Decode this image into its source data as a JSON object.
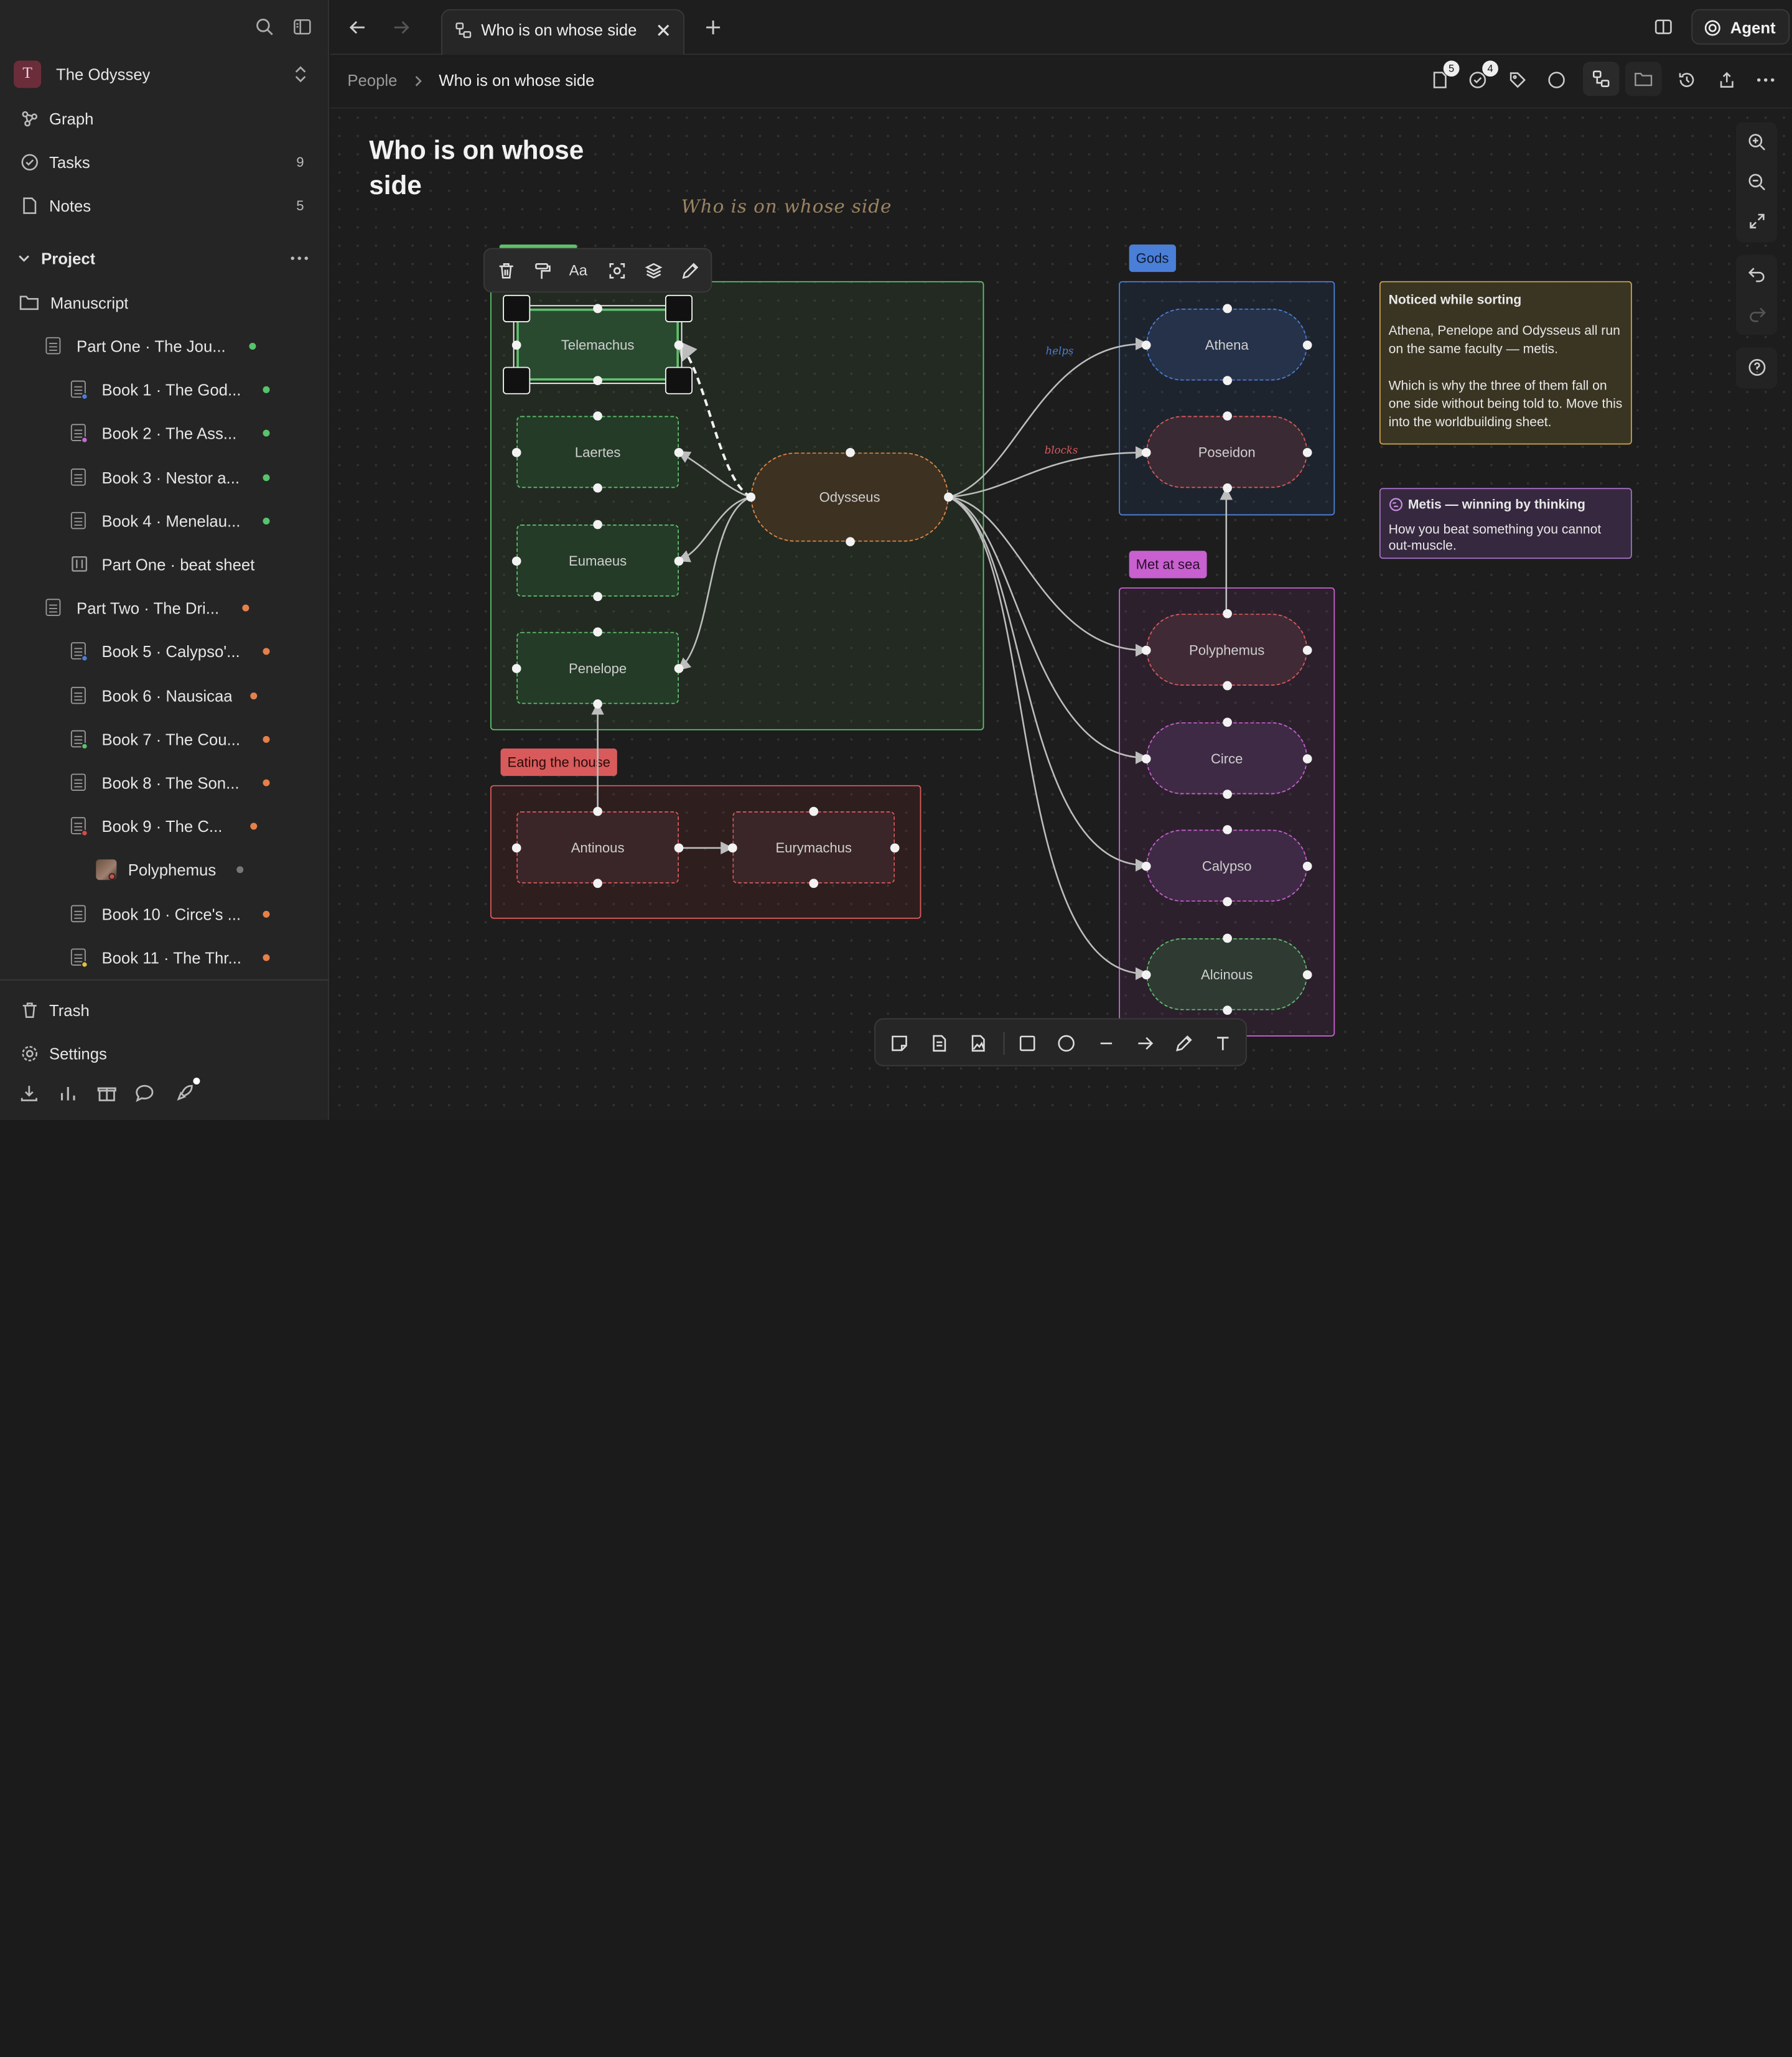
{
  "workspace": {
    "initial": "T",
    "name": "The Odyssey"
  },
  "nav": {
    "graph": "Graph",
    "tasks": "Tasks",
    "tasks_count": "9",
    "notes": "Notes",
    "notes_count": "5"
  },
  "project": {
    "label": "Project",
    "folder": "Manuscript",
    "items": [
      {
        "label": "Part One · The Jou...",
        "dot": "#57c46b"
      },
      {
        "label": "Book 1 · The God...",
        "dot": "#57c46b",
        "sub": "#4a7fd8"
      },
      {
        "label": "Book 2 · The Ass...",
        "dot": "#57c46b",
        "sub": "#c46ad8"
      },
      {
        "label": "Book 3 · Nestor a...",
        "dot": "#57c46b"
      },
      {
        "label": "Book 4 · Menelau...",
        "dot": "#57c46b"
      },
      {
        "label": "Part One · beat sheet"
      },
      {
        "label": "Part Two · The Dri...",
        "dot": "#e5804a"
      },
      {
        "label": "Book 5 · Calypso'...",
        "dot": "#e5804a",
        "sub": "#4a7fd8"
      },
      {
        "label": "Book 6 · Nausicaa",
        "dot": "#e5804a"
      },
      {
        "label": "Book 7 · The Cou...",
        "dot": "#e5804a",
        "sub": "#57c46b"
      },
      {
        "label": "Book 8 · The Son...",
        "dot": "#e5804a"
      },
      {
        "label": "Book 9 · The C...",
        "dot": "#e5804a",
        "sub": "#d84a4a"
      },
      {
        "label": "Polyphemus",
        "dot": "#777"
      },
      {
        "label": "Book 10 · Circe's ...",
        "dot": "#e5804a"
      },
      {
        "label": "Book 11 · The Thr...",
        "dot": "#e5804a",
        "sub": "#e0c040"
      }
    ]
  },
  "footer": {
    "trash": "Trash",
    "settings": "Settings"
  },
  "tab": {
    "title": "Who is on whose side"
  },
  "breadcrumb": {
    "parent": "People",
    "current": "Who is on whose side"
  },
  "badges": {
    "docs": "5",
    "tasks": "4"
  },
  "agent": "Agent",
  "canvas": {
    "title": "Who is on whose side",
    "handwritten": "Who is on whose side",
    "groups": {
      "gods": "Gods",
      "met": "Met at sea",
      "eating": "Eating the house"
    },
    "nodes": {
      "telemachus": "Telemachus",
      "laertes": "Laertes",
      "eumaeus": "Eumaeus",
      "penelope": "Penelope",
      "odysseus": "Odysseus",
      "athena": "Athena",
      "poseidon": "Poseidon",
      "polyphemus": "Polyphemus",
      "circe": "Circe",
      "calypso": "Calypso",
      "alcinous": "Alcinous",
      "antinous": "Antinous",
      "eurymachus": "Eurymachus"
    },
    "edge_labels": {
      "helps": "helps",
      "blocks": "blocks"
    },
    "notes": {
      "noticed_title": "Noticed while sorting",
      "noticed_p1": "Athena, Penelope and Odysseus all run on the same faculty — metis.",
      "noticed_p2": "Which is why the three of them fall on one side without being told to. Move this into the worldbuilding sheet.",
      "metis_title": "Metis — winning by thinking",
      "metis_body": "How you beat something you cannot out-muscle."
    }
  },
  "colors": {
    "green": "#5cb86a",
    "blue": "#4a7fd8",
    "pink": "#c860d0",
    "red": "#d85a5a",
    "orange": "#e08a4a",
    "note_yellow": "#c8a24a",
    "note_purple": "#a070c0"
  }
}
